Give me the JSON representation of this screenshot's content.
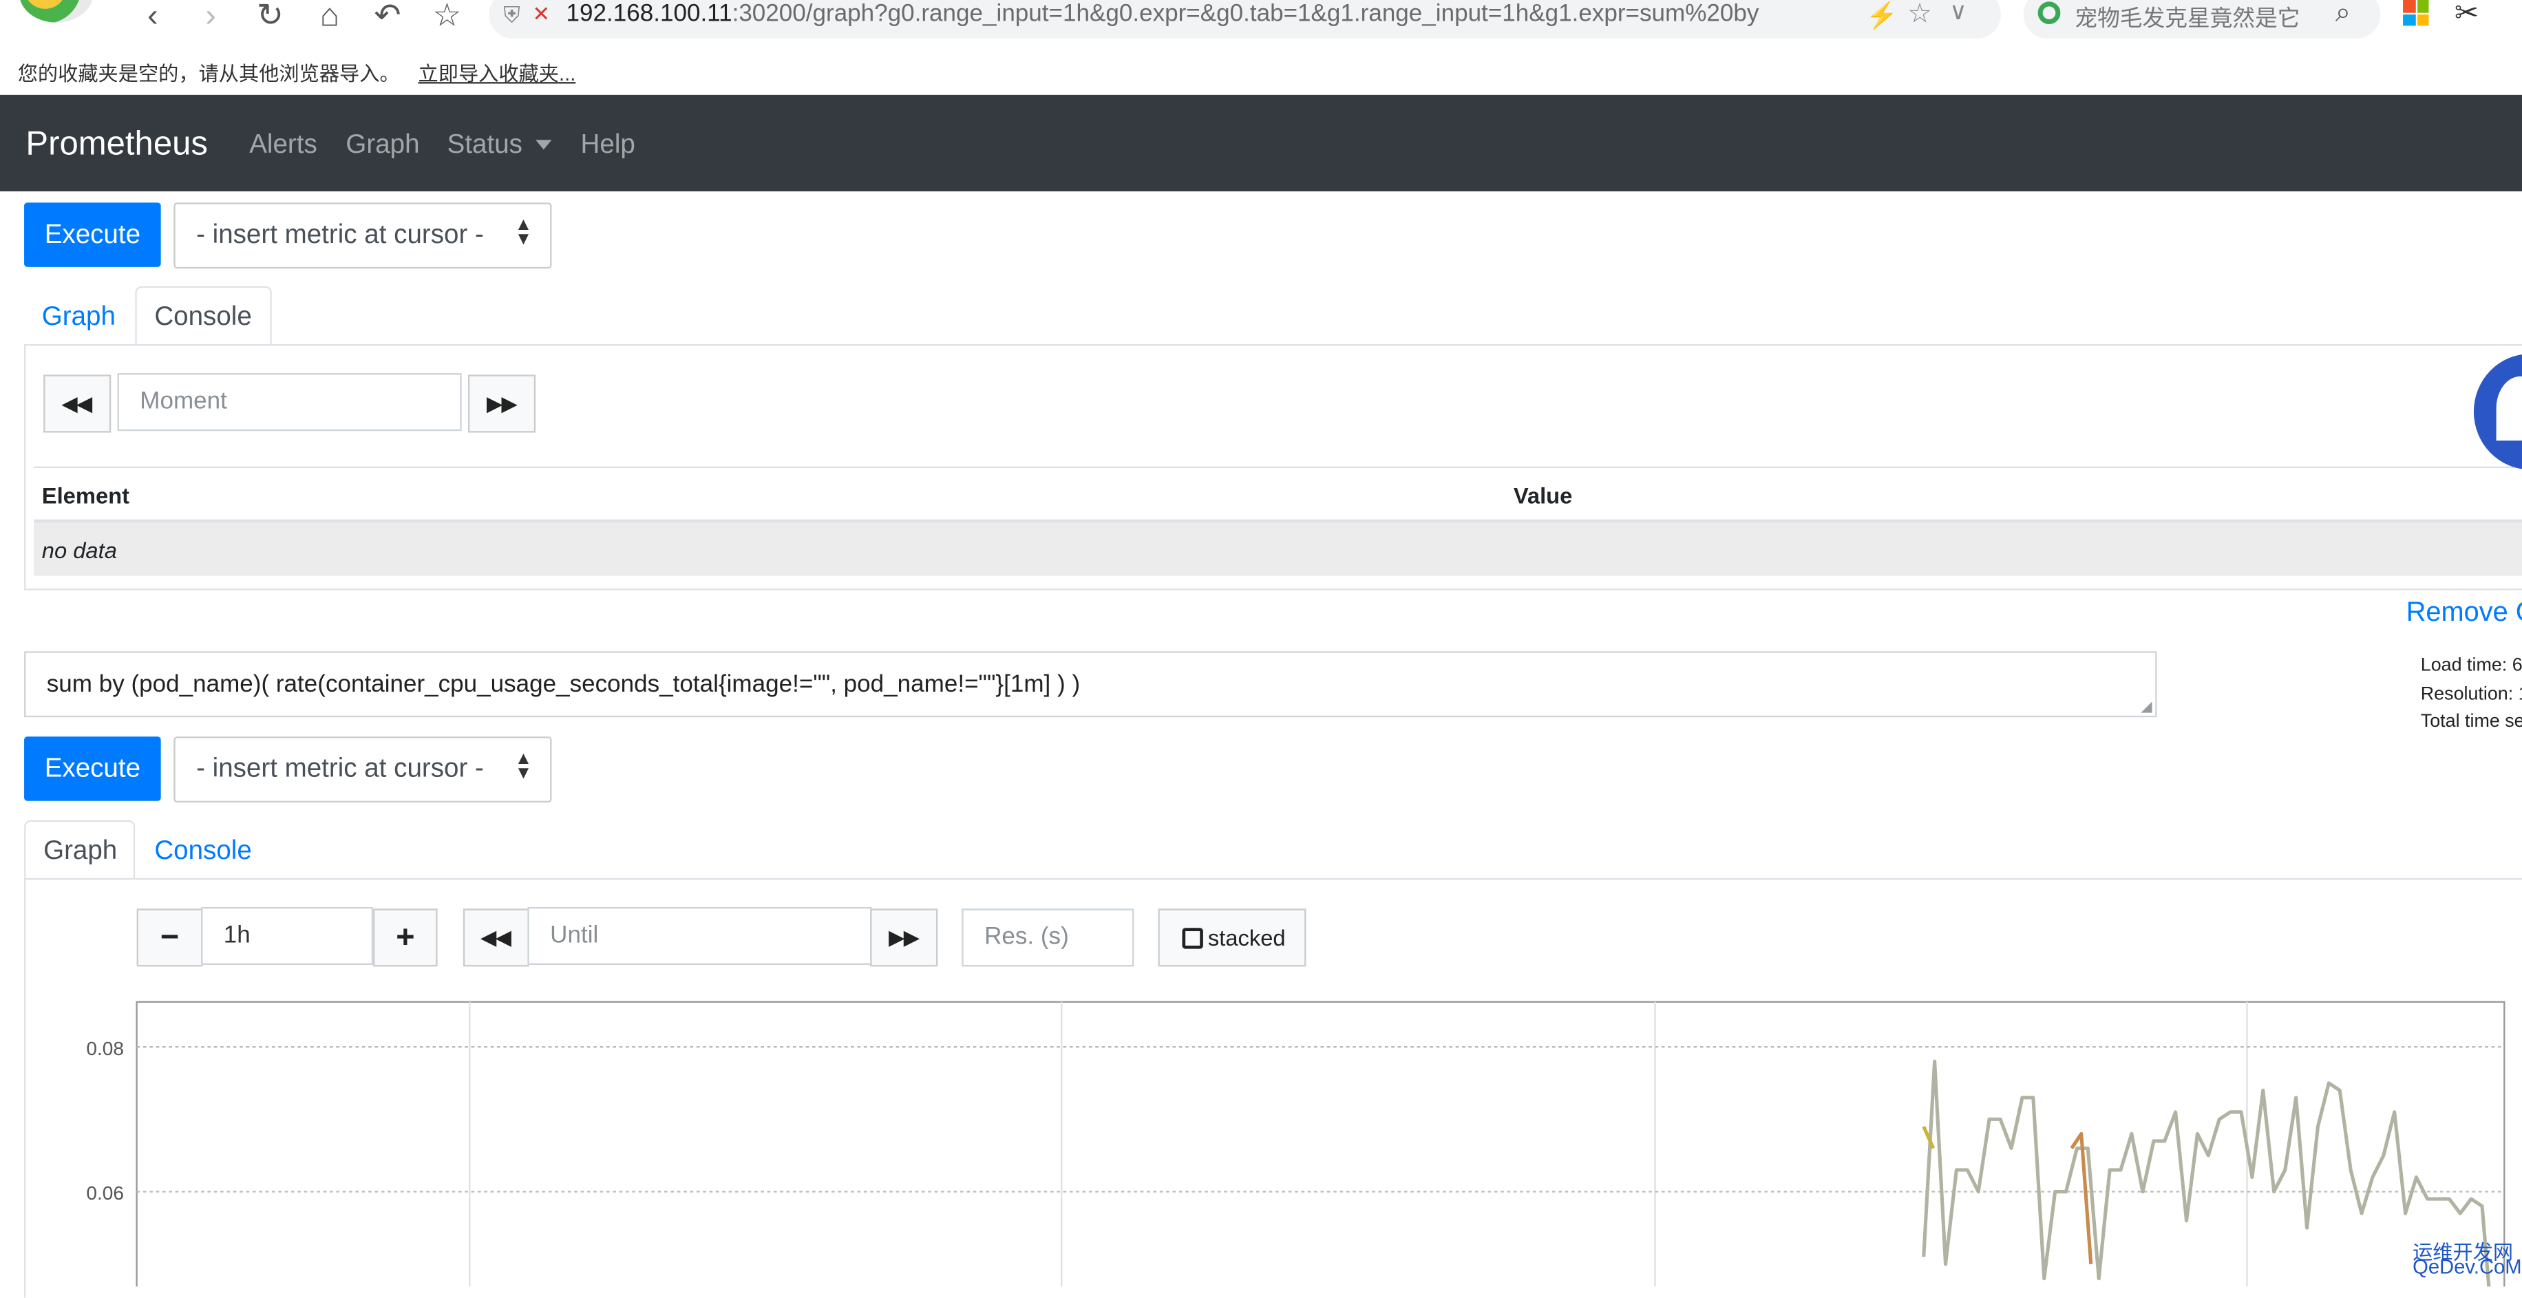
{
  "browser": {
    "address_host": "192.168.100.11",
    "address_rest": ":30200/graph?g0.range_input=1h&g0.expr=&g0.tab=1&g1.range_input=1h&g1.expr=sum%20by",
    "search_text": "宠物毛发克星竟然是它",
    "bookmark_message": "您的收藏夹是空的，请从其他浏览器导入。",
    "bookmark_import_link": "立即导入收藏夹..."
  },
  "navbar": {
    "brand": "Prometheus",
    "links": [
      "Alerts",
      "Graph",
      "Status",
      "Help"
    ]
  },
  "panel0": {
    "execute_label": "Execute",
    "metric_select": "- insert metric at cursor -",
    "tabs": [
      "Graph",
      "Console"
    ],
    "active_tab": "Console",
    "moment_placeholder": "Moment",
    "table_headers": [
      "Element",
      "Value"
    ],
    "no_data": "no data",
    "remove_graph": "Remove G"
  },
  "panel1": {
    "expression": "sum by (pod_name)( rate(container_cpu_usage_seconds_total{image!=\"\", pod_name!=\"\"}[1m] ) )",
    "execute_label": "Execute",
    "metric_select": "- insert metric at cursor -",
    "tabs": [
      "Graph",
      "Console"
    ],
    "active_tab": "Graph",
    "range_value": "1h",
    "until_placeholder": "Until",
    "res_placeholder": "Res. (s)",
    "stacked_label": "stacked",
    "stats": [
      "Load time: 6",
      "Resolution: 1",
      "Total time se"
    ]
  },
  "chart_data": {
    "type": "line",
    "yticks": [
      "0.08",
      "0.06"
    ],
    "series": [
      {
        "color": "#b0b3a1",
        "values": [
          0.051,
          0.078,
          0.05,
          0.063,
          0.063,
          0.06,
          0.07,
          0.07,
          0.066,
          0.073,
          0.073,
          0.048,
          0.06,
          0.06,
          0.066,
          0.066,
          0.048,
          0.063,
          0.063,
          0.068,
          0.06,
          0.067,
          0.067,
          0.071,
          0.056,
          0.068,
          0.065,
          0.07,
          0.071,
          0.071,
          0.062,
          0.074,
          0.06,
          0.063,
          0.073,
          0.055,
          0.069,
          0.075,
          0.074,
          0.063,
          0.057,
          0.062,
          0.065,
          0.071,
          0.057,
          0.062,
          0.059,
          0.059,
          0.059,
          0.057,
          0.059,
          0.058,
          0.04
        ]
      },
      {
        "color": "#c8b43a",
        "values": [
          0.069,
          0.066
        ]
      },
      {
        "color": "#c98a4b",
        "values": [
          0.066,
          0.068,
          0.05
        ]
      }
    ]
  },
  "watermark": {
    "line1": "运维开发网",
    "line2": "QeDev.CoM"
  },
  "colors": {
    "navbar": "#343a40",
    "primary": "#007bff"
  }
}
